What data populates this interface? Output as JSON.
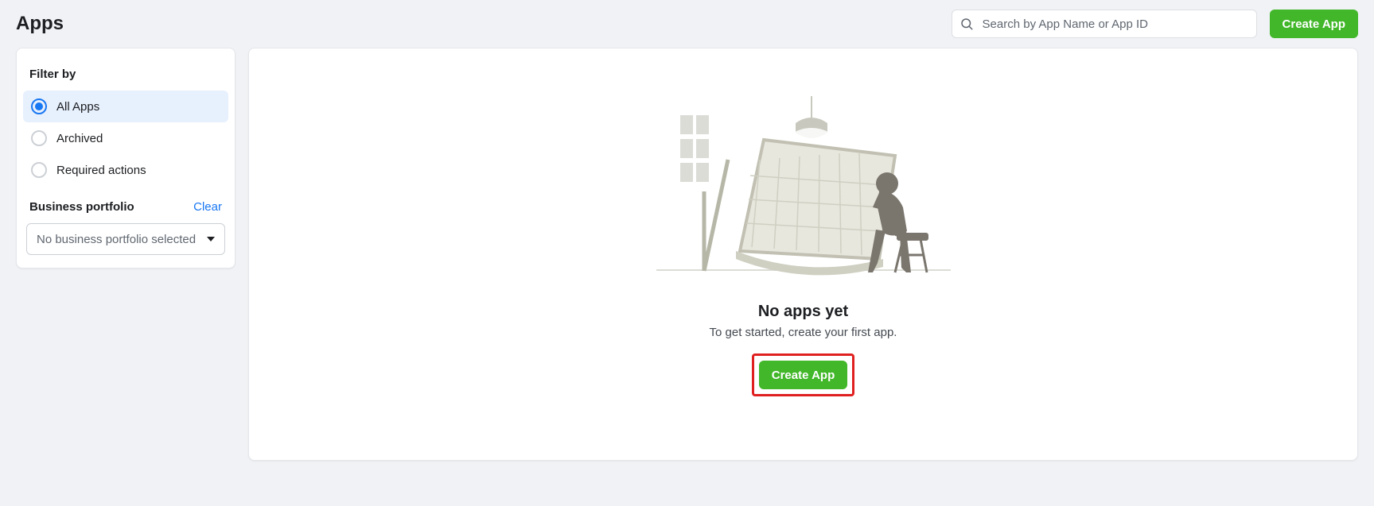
{
  "header": {
    "title": "Apps",
    "search_placeholder": "Search by App Name or App ID",
    "create_button": "Create App"
  },
  "sidebar": {
    "filter_title": "Filter by",
    "filters": [
      {
        "label": "All Apps",
        "selected": true
      },
      {
        "label": "Archived",
        "selected": false
      },
      {
        "label": "Required actions",
        "selected": false
      }
    ],
    "portfolio_title": "Business portfolio",
    "clear_label": "Clear",
    "portfolio_placeholder": "No business portfolio selected"
  },
  "empty_state": {
    "title": "No apps yet",
    "subtitle": "To get started, create your first app.",
    "button": "Create App"
  },
  "colors": {
    "accent_green": "#42b72a",
    "accent_blue": "#1877f2",
    "highlight_red": "#e02020"
  }
}
